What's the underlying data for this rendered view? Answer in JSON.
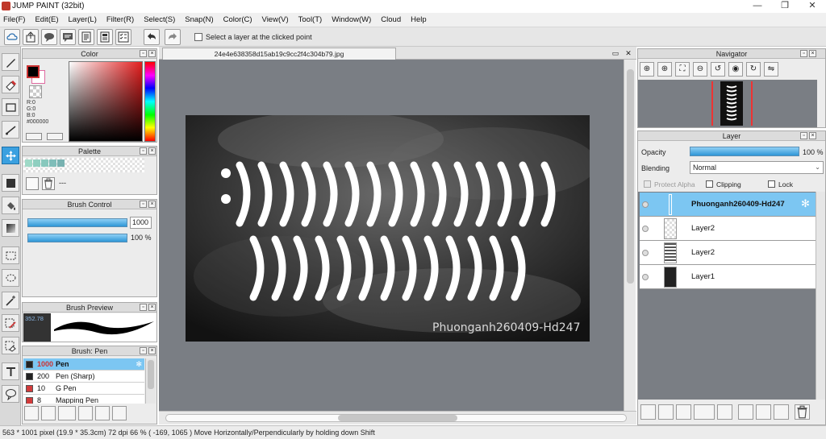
{
  "window": {
    "title": "JUMP PAINT (32bit)",
    "min": "—",
    "max": "❐",
    "close": "✕"
  },
  "menu": [
    "File(F)",
    "Edit(E)",
    "Layer(L)",
    "Filter(R)",
    "Select(S)",
    "Snap(N)",
    "Color(C)",
    "View(V)",
    "Tool(T)",
    "Window(W)",
    "Cloud",
    "Help"
  ],
  "toolbar": {
    "select_layer_label": "Select a layer at the clicked point"
  },
  "color_panel": {
    "title": "Color",
    "r": "R:0",
    "g": "G:0",
    "b": "B:0",
    "hex": "#000000"
  },
  "palette_panel": {
    "title": "Palette",
    "swatches": [
      "#9fd9c7",
      "#8fcfc0",
      "#88c8bd",
      "#7fbdb9",
      "#78b2b1"
    ],
    "placeholder": "---"
  },
  "brush_control": {
    "title": "Brush Control",
    "size": "1000",
    "opacity": "100 %"
  },
  "brush_preview": {
    "title": "Brush Preview",
    "value": "352.78"
  },
  "brush_list": {
    "title": "Brush: Pen",
    "items": [
      {
        "size": "1000",
        "name": "Pen",
        "color": "#222222"
      },
      {
        "size": "200",
        "name": "Pen (Sharp)",
        "color": "#222222"
      },
      {
        "size": "10",
        "name": "G Pen",
        "color": "#d23b3b"
      },
      {
        "size": "8",
        "name": "Mapping Pen",
        "color": "#d23b3b"
      }
    ]
  },
  "document": {
    "tab_name": "24e4e638358d15ab19c9cc2f4c304b79.jpg",
    "watermark": "Phuonganh260409-Hd247"
  },
  "navigator": {
    "title": "Navigator"
  },
  "layer_panel": {
    "title": "Layer",
    "opacity_label": "Opacity",
    "opacity_value": "100 %",
    "opacity_fraction": 1.0,
    "blending_label": "Blending",
    "blending_value": "Normal",
    "protect_alpha": "Protect Alpha",
    "clipping": "Clipping",
    "lock": "Lock",
    "layers": [
      {
        "name": "Phuonganh260409-Hd247",
        "selected": true
      },
      {
        "name": "Layer2",
        "selected": false
      },
      {
        "name": "Layer2",
        "selected": false
      },
      {
        "name": "Layer1",
        "selected": false
      }
    ]
  },
  "status": {
    "text": "563 * 1001 pixel   (19.9 * 35.3cm)   72 dpi   66 %   ( -169, 1065 )   Move Horizontally/Perpendicularly by holding down Shift"
  }
}
